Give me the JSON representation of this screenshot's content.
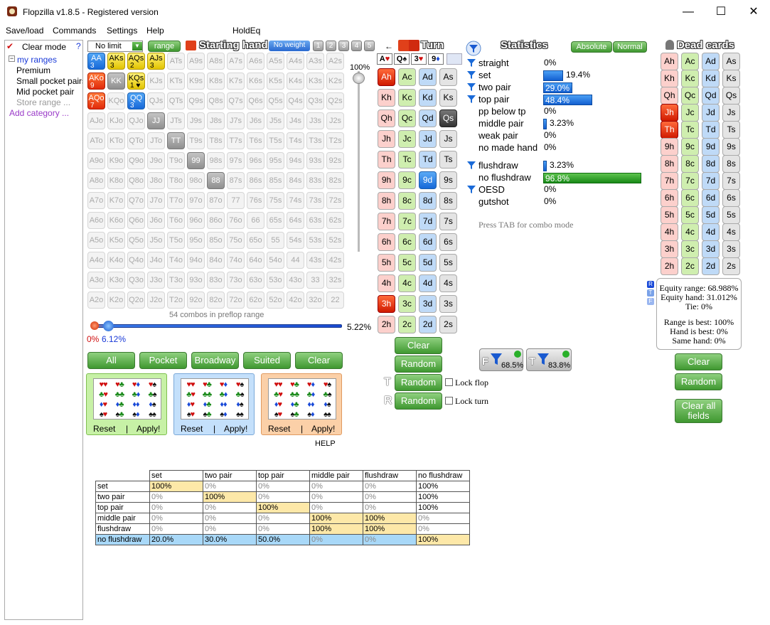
{
  "window": {
    "title": "Flopzilla v1.8.5 - Registered version",
    "minimize": "—",
    "maximize": "☐",
    "close": "✕"
  },
  "menu": [
    "Save/load",
    "Commands",
    "Settings",
    "Help",
    "HoldEq"
  ],
  "left_panel": {
    "clear_mode": "Clear mode",
    "help": "?",
    "root": "my ranges",
    "items": [
      "Premium",
      "Small pocket pairs",
      "Mid pocket pair",
      "Store range ...",
      "Add category ..."
    ]
  },
  "range": {
    "limit_select": "No limit",
    "range_button": "range",
    "header": "Starting hand",
    "no_weight": "No weight",
    "weights": [
      "1",
      "2",
      "3",
      "4",
      "5"
    ],
    "slider_percent": "100%",
    "combos_text": "54 combos in preflop range",
    "slider_left_red": "0%",
    "slider_left_blue": "6.12%",
    "slider_right": "5.22%",
    "matrix": [
      [
        "AA",
        "AKs",
        "AQs",
        "AJs",
        "ATs",
        "A9s",
        "A8s",
        "A7s",
        "A6s",
        "A5s",
        "A4s",
        "A3s",
        "A2s"
      ],
      [
        "AKo",
        "KK",
        "KQs",
        "KJs",
        "KTs",
        "K9s",
        "K8s",
        "K7s",
        "K6s",
        "K5s",
        "K4s",
        "K3s",
        "K2s"
      ],
      [
        "AQo",
        "KQo",
        "QQ",
        "QJs",
        "QTs",
        "Q9s",
        "Q8s",
        "Q7s",
        "Q6s",
        "Q5s",
        "Q4s",
        "Q3s",
        "Q2s"
      ],
      [
        "AJo",
        "KJo",
        "QJo",
        "JJ",
        "JTs",
        "J9s",
        "J8s",
        "J7s",
        "J6s",
        "J5s",
        "J4s",
        "J3s",
        "J2s"
      ],
      [
        "ATo",
        "KTo",
        "QTo",
        "JTo",
        "TT",
        "T9s",
        "T8s",
        "T7s",
        "T6s",
        "T5s",
        "T4s",
        "T3s",
        "T2s"
      ],
      [
        "A9o",
        "K9o",
        "Q9o",
        "J9o",
        "T9o",
        "99",
        "98s",
        "97s",
        "96s",
        "95s",
        "94s",
        "93s",
        "92s"
      ],
      [
        "A8o",
        "K8o",
        "Q8o",
        "J8o",
        "T8o",
        "98o",
        "88",
        "87s",
        "86s",
        "85s",
        "84s",
        "83s",
        "82s"
      ],
      [
        "A7o",
        "K7o",
        "Q7o",
        "J7o",
        "T7o",
        "97o",
        "87o",
        "77",
        "76s",
        "75s",
        "74s",
        "73s",
        "72s"
      ],
      [
        "A6o",
        "K6o",
        "Q6o",
        "J6o",
        "T6o",
        "96o",
        "86o",
        "76o",
        "66",
        "65s",
        "64s",
        "63s",
        "62s"
      ],
      [
        "A5o",
        "K5o",
        "Q5o",
        "J5o",
        "T5o",
        "95o",
        "85o",
        "75o",
        "65o",
        "55",
        "54s",
        "53s",
        "52s"
      ],
      [
        "A4o",
        "K4o",
        "Q4o",
        "J4o",
        "T4o",
        "94o",
        "84o",
        "74o",
        "64o",
        "54o",
        "44",
        "43s",
        "42s"
      ],
      [
        "A3o",
        "K3o",
        "Q3o",
        "J3o",
        "T3o",
        "93o",
        "83o",
        "73o",
        "63o",
        "53o",
        "43o",
        "33",
        "32s"
      ],
      [
        "A2o",
        "K2o",
        "Q2o",
        "J2o",
        "T2o",
        "92o",
        "82o",
        "72o",
        "62o",
        "52o",
        "42o",
        "32o",
        "22"
      ]
    ],
    "selected": {
      "AA": {
        "style": "sel-b",
        "count": "3"
      },
      "AKs": {
        "style": "sel-y",
        "count": "3"
      },
      "AQs": {
        "style": "sel-y",
        "count": "2"
      },
      "AJs": {
        "style": "sel-y",
        "count": "3"
      },
      "AKo": {
        "style": "sel-r",
        "count": "9"
      },
      "KK": {
        "style": "sel-g",
        "count": ""
      },
      "KQs": {
        "style": "sel-y",
        "count": "1 ♥"
      },
      "AQo": {
        "style": "sel-r",
        "count": "7"
      },
      "QQ": {
        "style": "sel-b",
        "count": "3"
      },
      "JJ": {
        "style": "sel-g",
        "count": ""
      },
      "TT": {
        "style": "sel-g",
        "count": ""
      },
      "99": {
        "style": "sel-g",
        "count": ""
      },
      "88": {
        "style": "sel-g",
        "count": ""
      }
    },
    "quick_buttons": [
      "All",
      "Pocket",
      "Broadway",
      "Suited",
      "Clear"
    ],
    "suit_boxes": [
      {
        "reset": "Reset",
        "sep": "|",
        "apply": "Apply!",
        "color": "#c7f1a6",
        "border": "#7fbf50"
      },
      {
        "reset": "Reset",
        "sep": "|",
        "apply": "Apply!",
        "color": "#c4e0fb",
        "border": "#7aa8d8"
      },
      {
        "reset": "Reset",
        "sep": "|",
        "apply": "Apply!",
        "color": "#fbd0a8",
        "border": "#e09a60"
      }
    ],
    "help": "HELP"
  },
  "board": {
    "header": "Turn",
    "flop": [
      {
        "rank": "A",
        "suit": "♥",
        "color": "#d01010"
      },
      {
        "rank": "Q",
        "suit": "♠",
        "color": "#111"
      },
      {
        "rank": "3",
        "suit": "♥",
        "color": "#d01010"
      },
      {
        "rank": "9",
        "suit": "♦",
        "color": "#1a4ad8"
      }
    ],
    "ranks": [
      "A",
      "K",
      "Q",
      "J",
      "T",
      "9",
      "8",
      "7",
      "6",
      "5",
      "4",
      "3",
      "2"
    ],
    "on": {
      "Ah": true,
      "Qs": true,
      "9d": true,
      "3h": true
    },
    "clear": "Clear",
    "random": "Random",
    "random_t": "Random",
    "random_r": "Random",
    "lock_flop": "Lock flop",
    "lock_turn": "Lock turn",
    "t_label": "T",
    "r_label": "R"
  },
  "stats": {
    "header": "Statistics",
    "absolute": "Absolute",
    "normal": "Normal",
    "rows": [
      {
        "label": "straight",
        "value": "0%",
        "bar": 0,
        "funnel": true
      },
      {
        "label": "set",
        "value": "19.4%",
        "bar": 19.4,
        "funnel": true,
        "outside": true
      },
      {
        "label": "two pair",
        "value": "29.0%",
        "bar": 29.0,
        "funnel": true
      },
      {
        "label": "top pair",
        "value": "48.4%",
        "bar": 48.4,
        "funnel": true
      },
      {
        "label": "pp below tp",
        "value": "0%",
        "bar": 0
      },
      {
        "label": "middle pair",
        "value": "3.23%",
        "bar": 3.23,
        "outside": true
      },
      {
        "label": "weak pair",
        "value": "0%",
        "bar": 0
      },
      {
        "label": "no made hand",
        "value": "0%",
        "bar": 0
      }
    ],
    "rows2": [
      {
        "label": "flushdraw",
        "value": "3.23%",
        "bar": 3.23,
        "funnel": true,
        "outside": true
      },
      {
        "label": "no flushdraw",
        "value": "96.8%",
        "bar": 96.8,
        "green": true
      },
      {
        "label": "OESD",
        "value": "0%",
        "bar": 0,
        "funnel": true
      },
      {
        "label": "gutshot",
        "value": "0%",
        "bar": 0
      }
    ],
    "hint": "Press TAB for combo mode",
    "filter_f": "68.5%",
    "filter_t": "83.8%",
    "filter_f_label": "F",
    "filter_t_label": "T"
  },
  "dead": {
    "header": "Dead cards",
    "on": {
      "Jh": true,
      "Th": true
    },
    "equity_range": "Equity range: 68.988%",
    "equity_hand": "Equity hand: 31.012%",
    "tie": "Tie: 0%",
    "range_best": "Range is best: 100%",
    "hand_best": "Hand is best: 0%",
    "same_hand": "Same hand: 0%",
    "clear": "Clear",
    "random": "Random",
    "clear_all": "Clear all fields",
    "tags": [
      "R",
      "T",
      "F"
    ]
  },
  "table": {
    "cols": [
      "set",
      "two pair",
      "top pair",
      "middle pair",
      "flushdraw",
      "no flushdraw"
    ],
    "rows": [
      {
        "label": "set",
        "cells": [
          "100%",
          "0%",
          "0%",
          "0%",
          "0%",
          "100%"
        ]
      },
      {
        "label": "two pair",
        "cells": [
          "0%",
          "100%",
          "0%",
          "0%",
          "0%",
          "100%"
        ]
      },
      {
        "label": "top pair",
        "cells": [
          "0%",
          "0%",
          "100%",
          "0%",
          "0%",
          "100%"
        ]
      },
      {
        "label": "middle pair",
        "cells": [
          "0%",
          "0%",
          "0%",
          "100%",
          "100%",
          "0%"
        ]
      },
      {
        "label": "flushdraw",
        "cells": [
          "0%",
          "0%",
          "0%",
          "100%",
          "100%",
          "0%"
        ]
      },
      {
        "label": "no flushdraw",
        "cells": [
          "20.0%",
          "30.0%",
          "50.0%",
          "0%",
          "0%",
          "100%"
        ]
      }
    ]
  }
}
